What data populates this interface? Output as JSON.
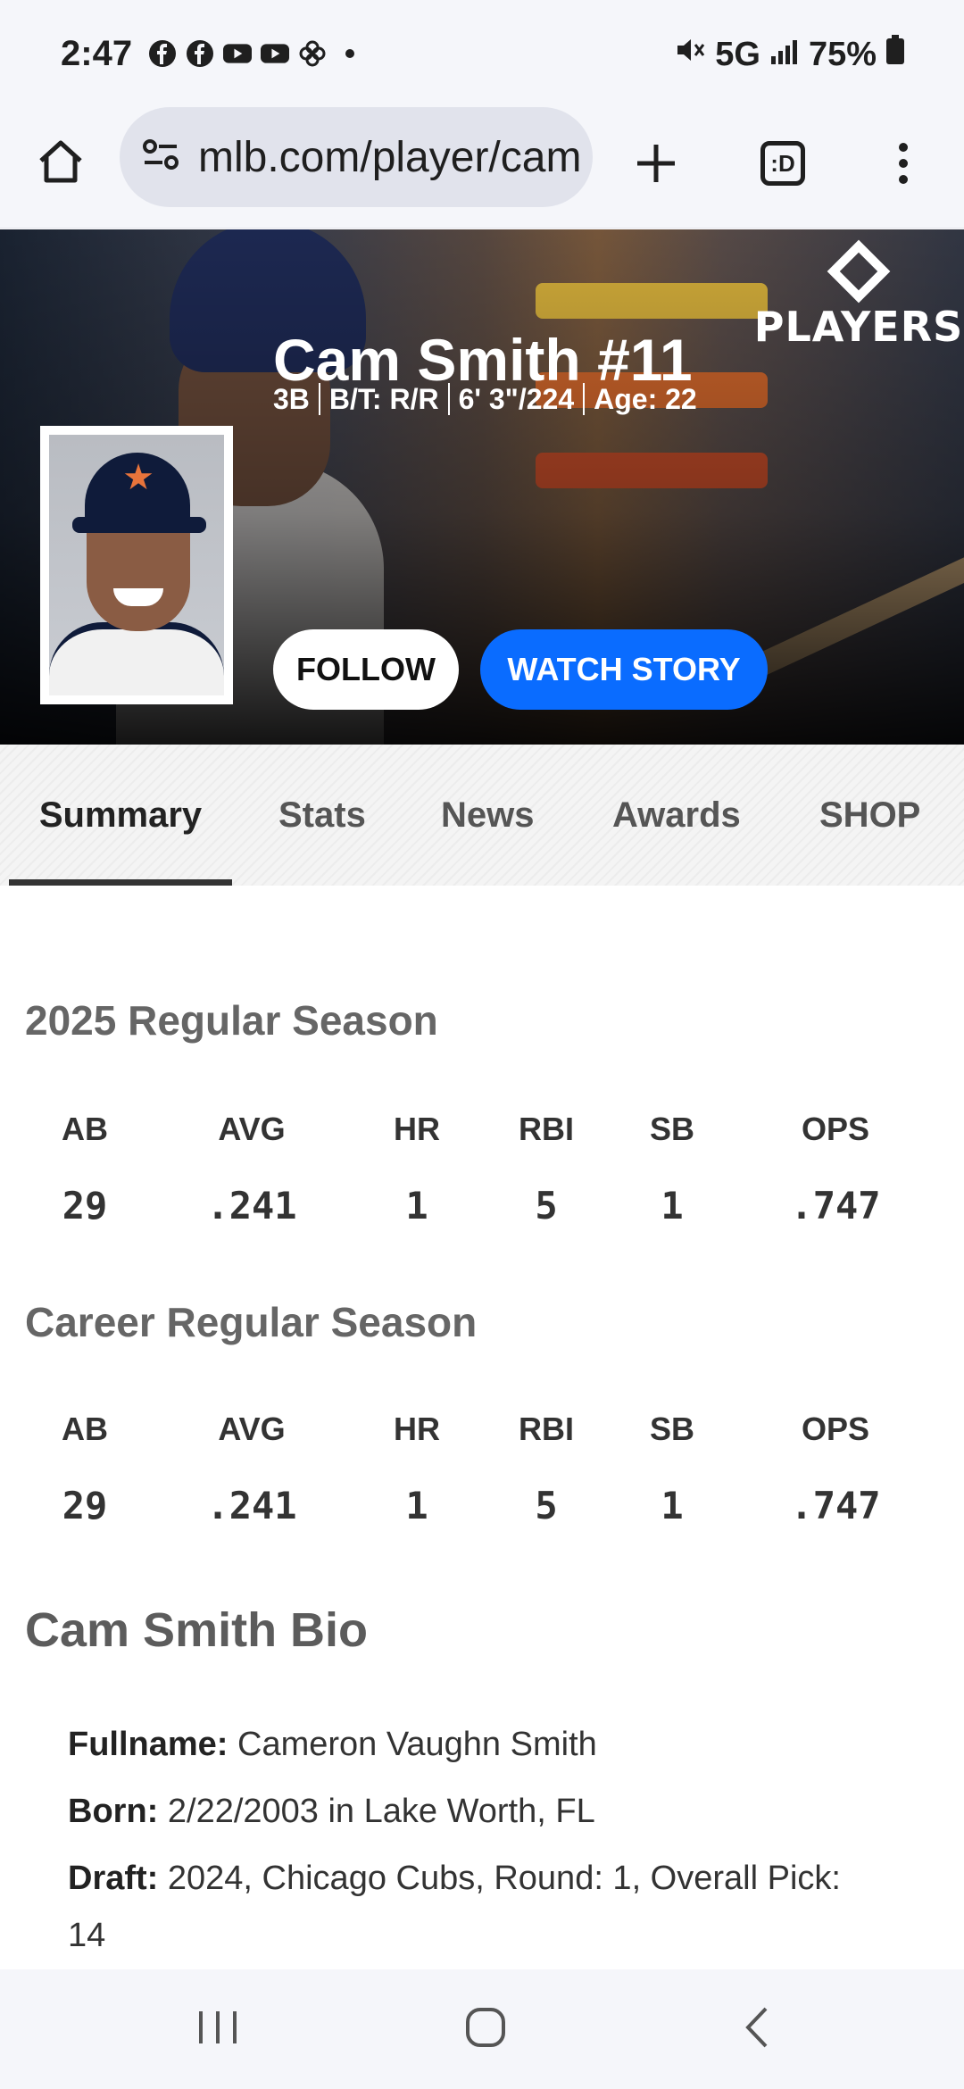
{
  "status_bar": {
    "time": "2:47",
    "network": "5G",
    "battery": "75%",
    "left_icons": [
      "facebook-icon",
      "facebook-icon",
      "youtube-icon",
      "youtube-icon",
      "pinwheel-icon",
      "dot-icon"
    ]
  },
  "browser": {
    "url": "mlb.com/player/cam"
  },
  "hero": {
    "logo_text": "PLAYERS",
    "player_name": "Cam Smith #11",
    "meta": [
      "3B",
      "B/T: R/R",
      "6' 3\"/224",
      "Age: 22"
    ],
    "follow_label": "FOLLOW",
    "watch_label": "WATCH STORY"
  },
  "tabs": [
    {
      "label": "Summary",
      "active": true
    },
    {
      "label": "Stats",
      "active": false
    },
    {
      "label": "News",
      "active": false
    },
    {
      "label": "Awards",
      "active": false
    },
    {
      "label": "SHOP",
      "active": false
    }
  ],
  "season_stats": {
    "title": "2025 Regular Season",
    "headers": [
      "AB",
      "AVG",
      "HR",
      "RBI",
      "SB",
      "OPS"
    ],
    "values": [
      "29",
      ".241",
      "1",
      "5",
      "1",
      ".747"
    ]
  },
  "career_stats": {
    "title": "Career Regular Season",
    "headers": [
      "AB",
      "AVG",
      "HR",
      "RBI",
      "SB",
      "OPS"
    ],
    "values": [
      "29",
      ".241",
      "1",
      "5",
      "1",
      ".747"
    ]
  },
  "bio": {
    "title": "Cam Smith Bio",
    "fullname_label": "Fullname:",
    "fullname": "Cameron Vaughn Smith",
    "born_label": "Born:",
    "born": "2/22/2003 in Lake Worth, FL",
    "draft_label": "Draft:",
    "draft": "2024, Chicago Cubs, Round: 1, Overall Pick: 14"
  },
  "colors": {
    "accent_blue": "#0a6cff",
    "section_gray": "#666666"
  }
}
